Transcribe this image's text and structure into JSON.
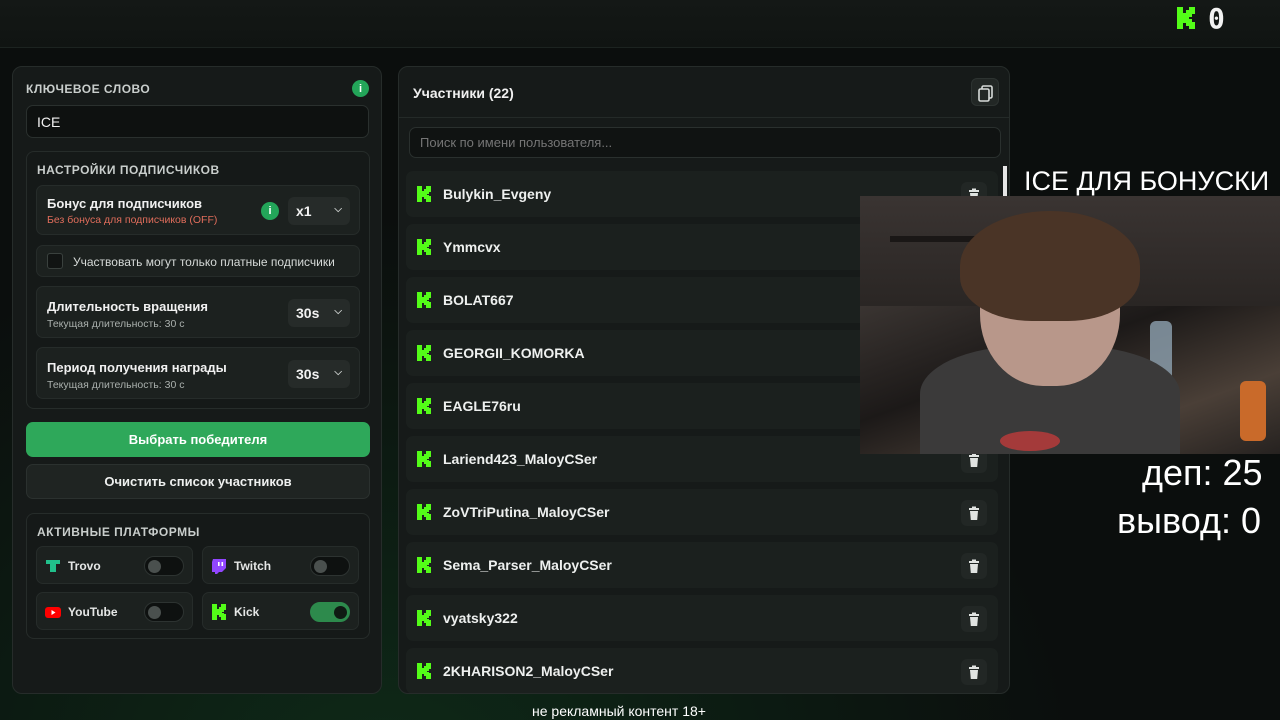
{
  "topbar": {
    "kick_count": "0",
    "kick_logo": "kick-logo-icon"
  },
  "keyword": {
    "title": "КЛЮЧЕВОЕ СЛОВО",
    "value": "ICE",
    "info": "i"
  },
  "subscribers": {
    "title": "НАСТРОЙКИ ПОДПИСЧИКОВ",
    "bonus_title": "Бонус для подписчиков",
    "bonus_sub": "Без бонуса для подписчиков (OFF)",
    "bonus_info": "i",
    "bonus_value": "x1",
    "paid_only_label": "Участвовать могут только платные подписчики",
    "spin_title": "Длительность вращения",
    "spin_sub": "Текущая длительность: 30 с",
    "spin_value": "30s",
    "reward_title": "Период получения награды",
    "reward_sub": "Текущая длительность: 30 с",
    "reward_value": "30s"
  },
  "actions": {
    "pick_winner": "Выбрать победителя",
    "clear_list": "Очистить список участников"
  },
  "platforms": {
    "title": "АКТИВНЫЕ ПЛАТФОРМЫ",
    "items": [
      {
        "label": "Trovo",
        "enabled": false,
        "icon": "trovo-icon",
        "color": "#21c08b"
      },
      {
        "label": "Twitch",
        "enabled": false,
        "icon": "twitch-icon",
        "color": "#9146ff"
      },
      {
        "label": "YouTube",
        "enabled": false,
        "icon": "youtube-icon",
        "color": "#ff0000"
      },
      {
        "label": "Kick",
        "enabled": true,
        "icon": "kick-icon",
        "color": "#53fc18"
      }
    ]
  },
  "participants": {
    "title": "Участники (22)",
    "search_placeholder": "Поиск по имени пользователя...",
    "list": [
      "Bulykin_Evgeny",
      "Ymmcvx",
      "BOLAT667",
      "GEORGII_KOMORKA",
      "EAGLE76ru",
      "Lariend423_MaloyCSer",
      "ZoVTriPutina_MaloyCSer",
      "Sema_Parser_MaloyCSer",
      "vyatsky322",
      "2KHARISON2_MaloyCSer"
    ]
  },
  "overlay": {
    "keyword_banner": "ICE ДЛЯ БОНУСКИ",
    "dep": "деп: 25",
    "vyvod": "вывод: 0",
    "footer": "не рекламный контент 18+"
  },
  "colors": {
    "accent": "#2ea85a",
    "kick": "#53fc18",
    "panel": "#161a19"
  }
}
